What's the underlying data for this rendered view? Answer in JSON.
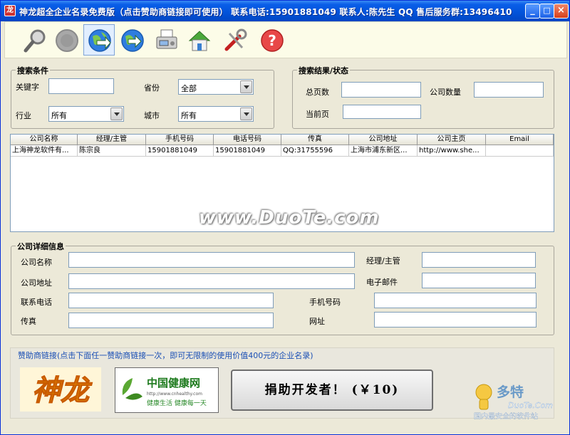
{
  "window": {
    "title": "神龙超全企业名录免费版（点击赞助商链接即可使用） 联系电话:15901881049 联系人:陈先生 QQ 售后服务群:13496410",
    "app_icon_char": "龙",
    "minimize": "_",
    "maximize": "□",
    "close": "×"
  },
  "toolbar": {
    "tools": [
      "search-icon",
      "stop-icon",
      "globe-arrow-icon",
      "globe-next-icon",
      "fax-icon",
      "home-icon",
      "tools-icon",
      "help-icon"
    ]
  },
  "search_conditions": {
    "legend": "搜索条件",
    "keyword_label": "关键字",
    "keyword_value": "",
    "province_label": "省份",
    "province_value": "全部",
    "industry_label": "行业",
    "industry_value": "所有",
    "city_label": "城市",
    "city_value": "所有"
  },
  "search_status": {
    "legend": "搜索结果/状态",
    "total_pages_label": "总页数",
    "total_pages_value": "",
    "company_count_label": "公司数量",
    "company_count_value": "",
    "current_page_label": "当前页",
    "current_page_value": ""
  },
  "results_table": {
    "columns": [
      "公司名称",
      "经理/主管",
      "手机号码",
      "电话号码",
      "传真",
      "公司地址",
      "公司主页",
      "Email"
    ],
    "rows": [
      [
        "上海神龙软件有...",
        "陈宗良",
        "15901881049",
        "15901881049",
        "QQ:31755596",
        "上海市浦东新区...",
        "http://www.she...",
        ""
      ]
    ]
  },
  "watermark": "www.DuoTe.com",
  "details": {
    "legend": "公司详细信息",
    "company_name_label": "公司名称",
    "manager_label": "经理/主管",
    "address_label": "公司地址",
    "email_label": "电子邮件",
    "phone_label": "联系电话",
    "mobile_label": "手机号码",
    "fax_label": "传真",
    "website_label": "网址"
  },
  "sponsor": {
    "caption": "赞助商链接(点击下面任一赞助商链接一次，即可无限制的使用价值400元的企业名录)",
    "shenlong_logo": "神龙",
    "health_logo_title": "中国健康网",
    "health_logo_url": "http://www.cnhealthy.com",
    "health_logo_slogan": "健康生活 健康每一天",
    "donate_label": "捐助开发者！ (￥10)"
  },
  "duote_badge": {
    "brand": "多特",
    "site": "DuoTe.Com",
    "slogan": "国内最安全的软件站"
  },
  "colors": {
    "titlebar": "#0252d9",
    "window_bg": "#ece9d8",
    "toolbar_bg": "#fcfce8",
    "sponsor_caption": "#1a4fb5",
    "logo_red": "#e8a800"
  }
}
